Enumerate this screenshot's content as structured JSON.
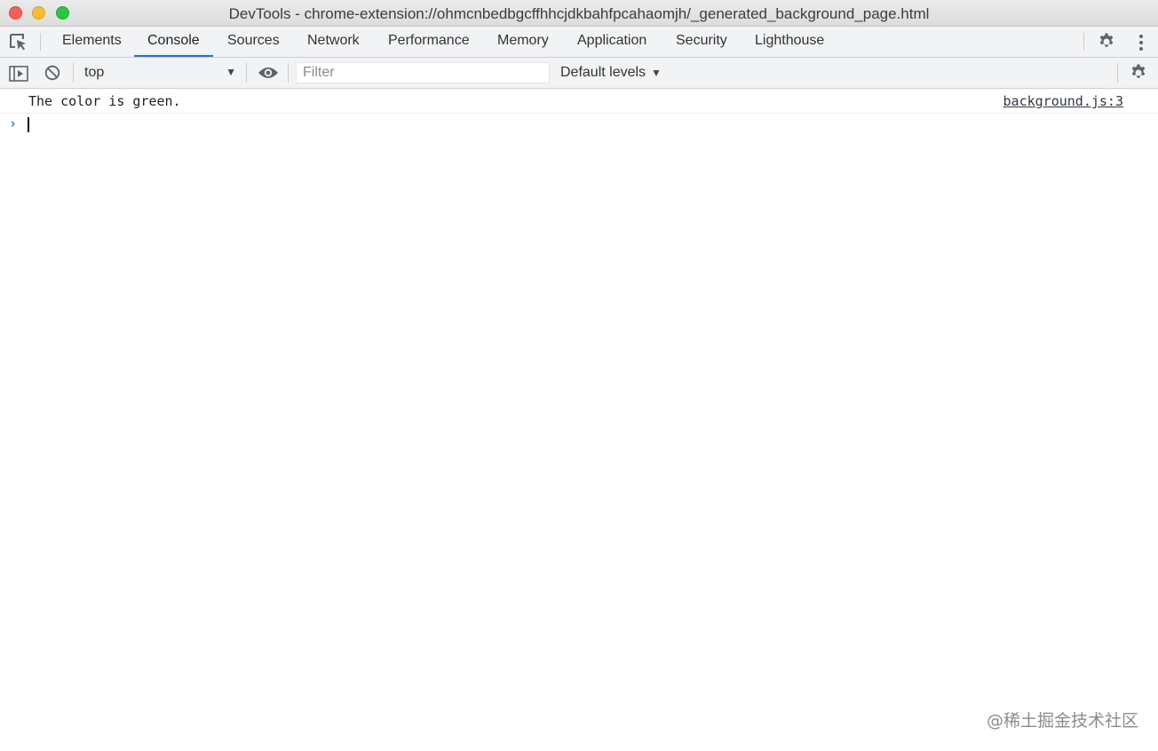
{
  "window": {
    "title": "DevTools - chrome-extension://ohmcnbedbgcffhhcjdkbahfpcahaomjh/_generated_background_page.html"
  },
  "tabs": [
    {
      "label": "Elements",
      "active": false
    },
    {
      "label": "Console",
      "active": true
    },
    {
      "label": "Sources",
      "active": false
    },
    {
      "label": "Network",
      "active": false
    },
    {
      "label": "Performance",
      "active": false
    },
    {
      "label": "Memory",
      "active": false
    },
    {
      "label": "Application",
      "active": false
    },
    {
      "label": "Security",
      "active": false
    },
    {
      "label": "Lighthouse",
      "active": false
    }
  ],
  "toolbar": {
    "context": "top",
    "filter_placeholder": "Filter",
    "filter_value": "",
    "levels_label": "Default levels"
  },
  "console": {
    "messages": [
      {
        "text": "The color is green.",
        "source": "background.js:3"
      }
    ],
    "prompt_symbol": "›"
  },
  "watermark": "@稀土掘金技术社区",
  "colors": {
    "accent": "#1a73e8",
    "close": "#fd5f57",
    "minimize": "#febc2e",
    "maximize": "#29c840",
    "toolbar_bg": "#f1f3f4"
  },
  "icons": {
    "inspect": "inspect-element-icon",
    "settings": "gear-icon",
    "more": "kebab-menu-icon",
    "sidebar": "show-sidebar-icon",
    "clear": "clear-console-icon",
    "live_expression": "eye-icon"
  }
}
